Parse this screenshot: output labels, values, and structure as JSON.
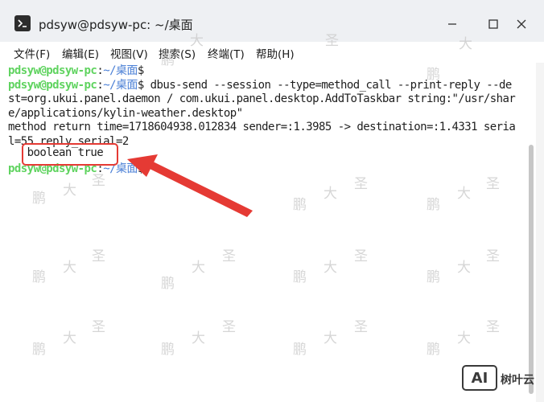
{
  "window": {
    "title": "pdsyw@pdsyw-pc: ~/桌面"
  },
  "menubar": {
    "items": [
      {
        "label": "文件(F)"
      },
      {
        "label": "编辑(E)"
      },
      {
        "label": "视图(V)"
      },
      {
        "label": "搜索(S)"
      },
      {
        "label": "终端(T)"
      },
      {
        "label": "帮助(H)"
      }
    ]
  },
  "terminal": {
    "prompt_user": "pdsyw@pdsyw-pc",
    "prompt_colon": ":",
    "prompt_path": "~/桌面",
    "prompt_dollar": "$",
    "command": " dbus-send --session --type=method_call --print-reply --de",
    "lines": [
      "st=org.ukui.panel.daemon / com.ukui.panel.desktop.AddToTaskbar string:\"/usr/shar",
      "e/applications/kylin-weather.desktop\"",
      "method return time=1718604938.012834 sender=:1.3985 -> destination=:1.4331 seria",
      "l=55 reply_serial=2",
      "   boolean true"
    ]
  },
  "annotation": {
    "highlight_color": "#e53a34",
    "arrow_color": "#e53a34"
  },
  "watermark": {
    "chars": [
      "鹏",
      "大",
      "圣"
    ]
  },
  "logo": {
    "mark": "AI",
    "text": "树叶云"
  },
  "colors": {
    "prompt_user": "#5fd35f",
    "prompt_path": "#4a7fd6",
    "titlebar_bg": "#eef0f3"
  }
}
